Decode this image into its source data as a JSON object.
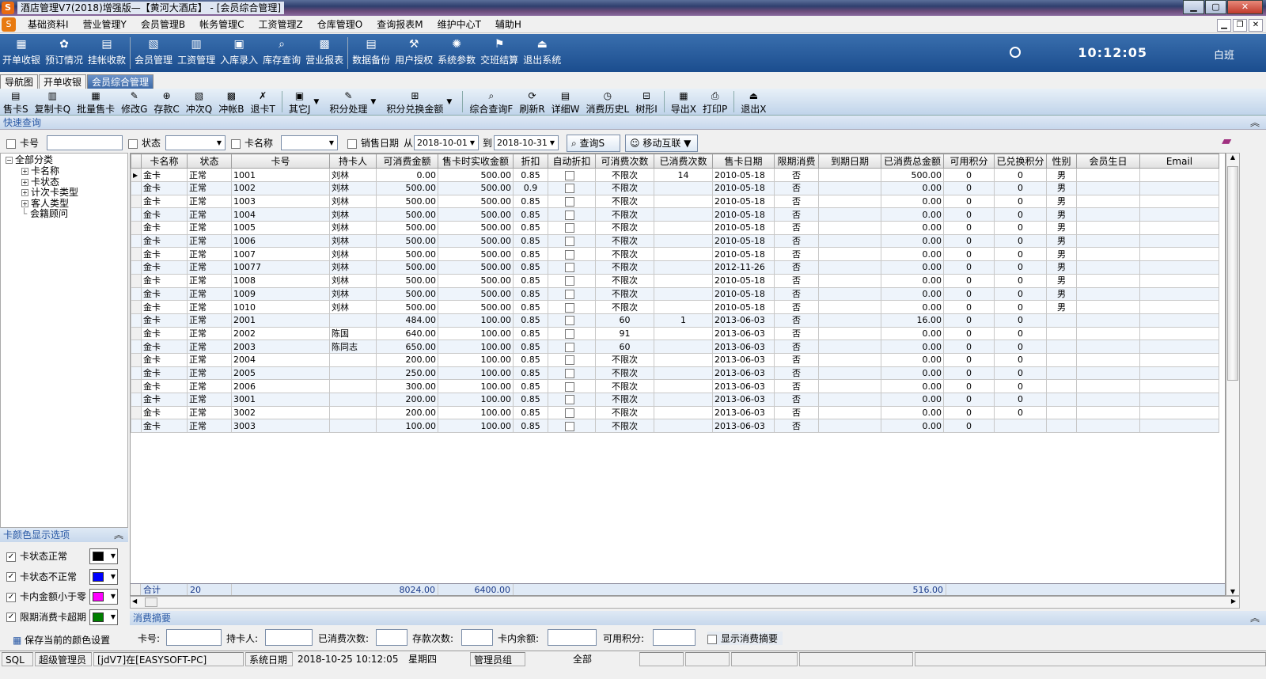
{
  "window": {
    "title": "酒店管理V7(2018)增强版—【黄河大酒店】 - [会员综合管理]",
    "min": "▁",
    "max": "▢",
    "close": "✕"
  },
  "menu": [
    "基础资料I",
    "营业管理Y",
    "会员管理B",
    "帐务管理C",
    "工资管理Z",
    "仓库管理O",
    "查询报表M",
    "维护中心T",
    "辅助H"
  ],
  "mdi": {
    "min": "▁",
    "restore": "❐",
    "close": "✕"
  },
  "main_toolbar": {
    "groups": [
      [
        {
          "label": "开单收银",
          "icon": "register-icon",
          "glyph": "▦"
        },
        {
          "label": "预订情况",
          "icon": "booking-icon",
          "glyph": "✿"
        },
        {
          "label": "挂帐收款",
          "icon": "ledger-icon",
          "glyph": "▤"
        }
      ],
      [
        {
          "label": "会员管理",
          "icon": "members-icon",
          "glyph": "▧"
        },
        {
          "label": "工资管理",
          "icon": "salary-icon",
          "glyph": "▥"
        },
        {
          "label": "入库录入",
          "icon": "stock-in-icon",
          "glyph": "▣"
        },
        {
          "label": "库存查询",
          "icon": "stock-query-icon",
          "glyph": "⌕"
        },
        {
          "label": "营业报表",
          "icon": "report-icon",
          "glyph": "▩"
        }
      ],
      [
        {
          "label": "数据备份",
          "icon": "backup-icon",
          "glyph": "▤"
        },
        {
          "label": "用户授权",
          "icon": "user-auth-icon",
          "glyph": "⚒"
        },
        {
          "label": "系统参数",
          "icon": "settings-icon",
          "glyph": "✺"
        },
        {
          "label": "交班结算",
          "icon": "shift-settle-icon",
          "glyph": "⚑"
        },
        {
          "label": "退出系统",
          "icon": "exit-icon",
          "glyph": "⏏"
        }
      ]
    ],
    "clock": "10:12:05",
    "shift": "白班"
  },
  "tabs": [
    "导航图",
    "开单收银",
    "会员综合管理"
  ],
  "active_tab": 2,
  "sub_toolbar": [
    {
      "label": "售卡S",
      "icon": "sell-card-icon",
      "glyph": "▤"
    },
    {
      "label": "复制卡Q",
      "icon": "copy-card-icon",
      "glyph": "▥"
    },
    {
      "label": "批量售卡",
      "icon": "batch-sell-icon",
      "glyph": "▦"
    },
    {
      "label": "修改G",
      "icon": "edit-icon",
      "glyph": "✎"
    },
    {
      "label": "存款C",
      "icon": "deposit-icon",
      "glyph": "⊕"
    },
    {
      "label": "冲次Q",
      "icon": "count-charge-icon",
      "glyph": "▧"
    },
    {
      "label": "冲帐B",
      "icon": "write-off-icon",
      "glyph": "▩"
    },
    {
      "label": "退卡T",
      "icon": "refund-card-icon",
      "glyph": "✗"
    },
    {
      "label": "其它J",
      "icon": "other-icon",
      "glyph": "▣",
      "dropdown": true
    },
    {
      "label": "积分处理",
      "icon": "points-icon",
      "glyph": "✎",
      "dropdown": true
    },
    {
      "label": "积分兑换金额",
      "icon": "points-exchange-icon",
      "glyph": "⊞",
      "dropdown": true
    },
    {
      "label": "综合查询F",
      "icon": "query-icon",
      "glyph": "⌕"
    },
    {
      "label": "刷新R",
      "icon": "refresh-icon",
      "glyph": "⟳"
    },
    {
      "label": "详细W",
      "icon": "detail-icon",
      "glyph": "▤"
    },
    {
      "label": "消费历史L",
      "icon": "history-icon",
      "glyph": "◷"
    },
    {
      "label": "树形I",
      "icon": "tree-icon",
      "glyph": "⊟"
    },
    {
      "label": "导出X",
      "icon": "export-icon",
      "glyph": "▦"
    },
    {
      "label": "打印P",
      "icon": "print-icon",
      "glyph": "⎙"
    },
    {
      "label": "退出X",
      "icon": "exit-icon",
      "glyph": "⏏"
    }
  ],
  "quick_query": {
    "header": "快速查询",
    "card_no_label": "卡号",
    "status_label": "状态",
    "card_name_label": "卡名称",
    "sale_date_label": "销售日期",
    "from_label": "从",
    "from_date": "2018-10-01",
    "to_label": "到",
    "to_date": "2018-10-31",
    "query_button": "查询S",
    "mobile_button": "移动互联"
  },
  "tree": {
    "root": "全部分类",
    "children": [
      "卡名称",
      "卡状态",
      "计次卡类型",
      "客人类型",
      "会籍顾问"
    ]
  },
  "color_panel": {
    "header": "卡颜色显示选项",
    "options": [
      {
        "label": "卡状态正常",
        "color": "#000000",
        "checked": true
      },
      {
        "label": "卡状态不正常",
        "color": "#0000ff",
        "checked": true
      },
      {
        "label": "卡内金额小于零",
        "color": "#ff00ff",
        "checked": true
      },
      {
        "label": "限期消费卡超期",
        "color": "#008000",
        "checked": true
      }
    ],
    "save_label": "保存当前的颜色设置"
  },
  "grid": {
    "columns": [
      "卡名称",
      "状态",
      "卡号",
      "持卡人",
      "可消费金额",
      "售卡时实收金额",
      "折扣",
      "自动折扣",
      "可消费次数",
      "已消费次数",
      "售卡日期",
      "限期消费",
      "到期日期",
      "已消费总金额",
      "可用积分",
      "已兑换积分",
      "性别",
      "会员生日",
      "Email"
    ],
    "rows": [
      [
        "金卡",
        "正常",
        "1001",
        "刘林",
        "0.00",
        "500.00",
        "0.85",
        "",
        "不限次",
        "14",
        "2010-05-18",
        "否",
        "",
        "500.00",
        "0",
        "0",
        "男",
        "",
        ""
      ],
      [
        "金卡",
        "正常",
        "1002",
        "刘林",
        "500.00",
        "500.00",
        "0.9",
        "",
        "不限次",
        "",
        "2010-05-18",
        "否",
        "",
        "0.00",
        "0",
        "0",
        "男",
        "",
        ""
      ],
      [
        "金卡",
        "正常",
        "1003",
        "刘林",
        "500.00",
        "500.00",
        "0.85",
        "",
        "不限次",
        "",
        "2010-05-18",
        "否",
        "",
        "0.00",
        "0",
        "0",
        "男",
        "",
        ""
      ],
      [
        "金卡",
        "正常",
        "1004",
        "刘林",
        "500.00",
        "500.00",
        "0.85",
        "",
        "不限次",
        "",
        "2010-05-18",
        "否",
        "",
        "0.00",
        "0",
        "0",
        "男",
        "",
        ""
      ],
      [
        "金卡",
        "正常",
        "1005",
        "刘林",
        "500.00",
        "500.00",
        "0.85",
        "",
        "不限次",
        "",
        "2010-05-18",
        "否",
        "",
        "0.00",
        "0",
        "0",
        "男",
        "",
        ""
      ],
      [
        "金卡",
        "正常",
        "1006",
        "刘林",
        "500.00",
        "500.00",
        "0.85",
        "",
        "不限次",
        "",
        "2010-05-18",
        "否",
        "",
        "0.00",
        "0",
        "0",
        "男",
        "",
        ""
      ],
      [
        "金卡",
        "正常",
        "1007",
        "刘林",
        "500.00",
        "500.00",
        "0.85",
        "",
        "不限次",
        "",
        "2010-05-18",
        "否",
        "",
        "0.00",
        "0",
        "0",
        "男",
        "",
        ""
      ],
      [
        "金卡",
        "正常",
        "10077",
        "刘林",
        "500.00",
        "500.00",
        "0.85",
        "",
        "不限次",
        "",
        "2012-11-26",
        "否",
        "",
        "0.00",
        "0",
        "0",
        "男",
        "",
        ""
      ],
      [
        "金卡",
        "正常",
        "1008",
        "刘林",
        "500.00",
        "500.00",
        "0.85",
        "",
        "不限次",
        "",
        "2010-05-18",
        "否",
        "",
        "0.00",
        "0",
        "0",
        "男",
        "",
        ""
      ],
      [
        "金卡",
        "正常",
        "1009",
        "刘林",
        "500.00",
        "500.00",
        "0.85",
        "",
        "不限次",
        "",
        "2010-05-18",
        "否",
        "",
        "0.00",
        "0",
        "0",
        "男",
        "",
        ""
      ],
      [
        "金卡",
        "正常",
        "1010",
        "刘林",
        "500.00",
        "500.00",
        "0.85",
        "",
        "不限次",
        "",
        "2010-05-18",
        "否",
        "",
        "0.00",
        "0",
        "0",
        "男",
        "",
        ""
      ],
      [
        "金卡",
        "正常",
        "2001",
        "",
        "484.00",
        "100.00",
        "0.85",
        "",
        "60",
        "1",
        "2013-06-03",
        "否",
        "",
        "16.00",
        "0",
        "0",
        "",
        "",
        ""
      ],
      [
        "金卡",
        "正常",
        "2002",
        "陈国",
        "640.00",
        "100.00",
        "0.85",
        "",
        "91",
        "",
        "2013-06-03",
        "否",
        "",
        "0.00",
        "0",
        "0",
        "",
        "",
        ""
      ],
      [
        "金卡",
        "正常",
        "2003",
        "陈同志",
        "650.00",
        "100.00",
        "0.85",
        "",
        "60",
        "",
        "2013-06-03",
        "否",
        "",
        "0.00",
        "0",
        "0",
        "",
        "",
        ""
      ],
      [
        "金卡",
        "正常",
        "2004",
        "",
        "200.00",
        "100.00",
        "0.85",
        "",
        "不限次",
        "",
        "2013-06-03",
        "否",
        "",
        "0.00",
        "0",
        "0",
        "",
        "",
        ""
      ],
      [
        "金卡",
        "正常",
        "2005",
        "",
        "250.00",
        "100.00",
        "0.85",
        "",
        "不限次",
        "",
        "2013-06-03",
        "否",
        "",
        "0.00",
        "0",
        "0",
        "",
        "",
        ""
      ],
      [
        "金卡",
        "正常",
        "2006",
        "",
        "300.00",
        "100.00",
        "0.85",
        "",
        "不限次",
        "",
        "2013-06-03",
        "否",
        "",
        "0.00",
        "0",
        "0",
        "",
        "",
        ""
      ],
      [
        "金卡",
        "正常",
        "3001",
        "",
        "200.00",
        "100.00",
        "0.85",
        "",
        "不限次",
        "",
        "2013-06-03",
        "否",
        "",
        "0.00",
        "0",
        "0",
        "",
        "",
        ""
      ],
      [
        "金卡",
        "正常",
        "3002",
        "",
        "200.00",
        "100.00",
        "0.85",
        "",
        "不限次",
        "",
        "2013-06-03",
        "否",
        "",
        "0.00",
        "0",
        "0",
        "",
        "",
        ""
      ],
      [
        "金卡",
        "正常",
        "3003",
        "",
        "100.00",
        "100.00",
        "0.85",
        "",
        "不限次",
        "",
        "2013-06-03",
        "否",
        "",
        "0.00",
        "0",
        "",
        "",
        "",
        ""
      ]
    ],
    "summary": {
      "label": "合计",
      "count": "20",
      "balance": "8024.00",
      "paid": "6400.00",
      "consumed": "516.00"
    }
  },
  "summary_panel": {
    "header": "消费摘要",
    "card_no": "卡号:",
    "holder": "持卡人:",
    "consumed_times": "已消费次数:",
    "deposit_times": "存款次数:",
    "balance": "卡内余额:",
    "points": "可用积分:",
    "show_summary": "显示消费摘要"
  },
  "status_bar": [
    "SQL",
    "超级管理员",
    "[jdV7]在[EASYSOFT-PC]",
    "系统日期",
    "2018-10-25   10:12:05",
    "星期四",
    "管理员组",
    "全部"
  ]
}
